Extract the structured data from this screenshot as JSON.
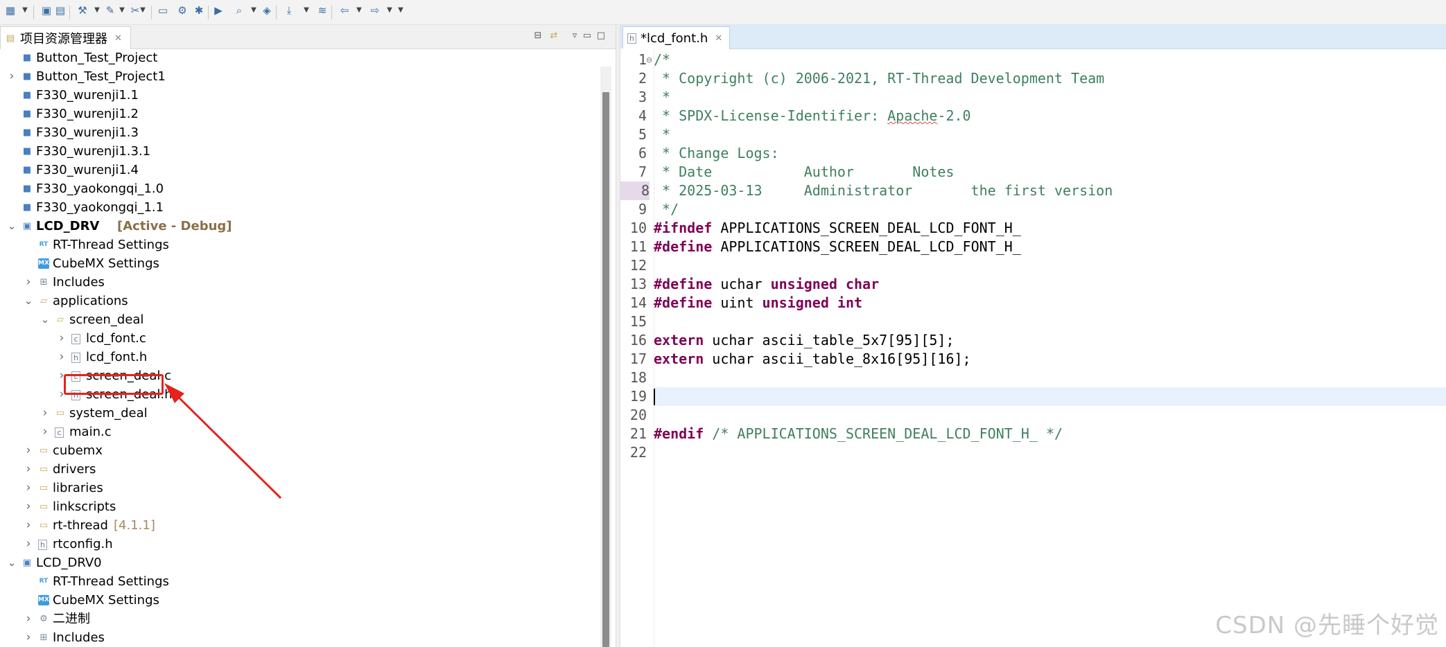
{
  "toolbar": {
    "icons": [
      "new-icon",
      "save-icon",
      "save-all-icon",
      "build-icon",
      "clean-icon",
      "tools-icon",
      "monitor-icon",
      "settings-icon",
      "debug-icon",
      "run-icon",
      "search-icon",
      "layers-icon",
      "download-icon",
      "stack-icon",
      "back-icon",
      "forward-icon"
    ]
  },
  "explorer": {
    "tab_label": "项目资源管理器",
    "tab_close": "✕"
  },
  "tree": [
    {
      "label": "Button_Test_Project",
      "deco": "",
      "bold": false,
      "depth": 0,
      "twisty": "",
      "icon": "project"
    },
    {
      "label": "Button_Test_Project1",
      "deco": "",
      "bold": false,
      "depth": 0,
      "twisty": ">",
      "icon": "project"
    },
    {
      "label": "F330_wurenji1.1",
      "deco": "",
      "bold": false,
      "depth": 0,
      "twisty": "",
      "icon": "project"
    },
    {
      "label": "F330_wurenji1.2",
      "deco": "",
      "bold": false,
      "depth": 0,
      "twisty": "",
      "icon": "project"
    },
    {
      "label": "F330_wurenji1.3",
      "deco": "",
      "bold": false,
      "depth": 0,
      "twisty": "",
      "icon": "project"
    },
    {
      "label": "F330_wurenji1.3.1",
      "deco": "",
      "bold": false,
      "depth": 0,
      "twisty": "",
      "icon": "project"
    },
    {
      "label": "F330_wurenji1.4",
      "deco": "",
      "bold": false,
      "depth": 0,
      "twisty": "",
      "icon": "project"
    },
    {
      "label": "F330_yaokongqi_1.0",
      "deco": "",
      "bold": false,
      "depth": 0,
      "twisty": "",
      "icon": "project"
    },
    {
      "label": "F330_yaokongqi_1.1",
      "deco": "",
      "bold": false,
      "depth": 0,
      "twisty": "",
      "icon": "project"
    },
    {
      "label": "LCD_DRV",
      "deco": "[Active - Debug]",
      "bold": true,
      "depth": 0,
      "twisty": "v",
      "icon": "project-active"
    },
    {
      "label": "RT-Thread Settings",
      "deco": "",
      "bold": false,
      "depth": 1,
      "twisty": "",
      "icon": "rt"
    },
    {
      "label": "CubeMX Settings",
      "deco": "",
      "bold": false,
      "depth": 1,
      "twisty": "",
      "icon": "mx"
    },
    {
      "label": "Includes",
      "deco": "",
      "bold": false,
      "depth": 1,
      "twisty": ">",
      "icon": "includes"
    },
    {
      "label": "applications",
      "deco": "",
      "bold": false,
      "depth": 1,
      "twisty": "v",
      "icon": "folder-open"
    },
    {
      "label": "screen_deal",
      "deco": "",
      "bold": false,
      "depth": 2,
      "twisty": "v",
      "icon": "folder-open"
    },
    {
      "label": "lcd_font.c",
      "deco": "",
      "bold": false,
      "depth": 3,
      "twisty": ">",
      "icon": "c-file"
    },
    {
      "label": "lcd_font.h",
      "deco": "",
      "bold": false,
      "depth": 3,
      "twisty": ">",
      "icon": "h-file"
    },
    {
      "label": "screen_deal.c",
      "deco": "",
      "bold": false,
      "depth": 3,
      "twisty": ">",
      "icon": "c-file"
    },
    {
      "label": "screen_deal.h",
      "deco": "",
      "bold": false,
      "depth": 3,
      "twisty": ">",
      "icon": "h-file"
    },
    {
      "label": "system_deal",
      "deco": "",
      "bold": false,
      "depth": 2,
      "twisty": ">",
      "icon": "folder"
    },
    {
      "label": "main.c",
      "deco": "",
      "bold": false,
      "depth": 2,
      "twisty": ">",
      "icon": "c-file"
    },
    {
      "label": "cubemx",
      "deco": "",
      "bold": false,
      "depth": 1,
      "twisty": ">",
      "icon": "folder"
    },
    {
      "label": "drivers",
      "deco": "",
      "bold": false,
      "depth": 1,
      "twisty": ">",
      "icon": "folder"
    },
    {
      "label": "libraries",
      "deco": "",
      "bold": false,
      "depth": 1,
      "twisty": ">",
      "icon": "folder"
    },
    {
      "label": "linkscripts",
      "deco": "",
      "bold": false,
      "depth": 1,
      "twisty": ">",
      "icon": "folder"
    },
    {
      "label": "rt-thread",
      "deco": "[4.1.1]",
      "bold": false,
      "depth": 1,
      "twisty": ">",
      "icon": "folder"
    },
    {
      "label": "rtconfig.h",
      "deco": "",
      "bold": false,
      "depth": 1,
      "twisty": ">",
      "icon": "h-file"
    },
    {
      "label": "LCD_DRV0",
      "deco": "",
      "bold": false,
      "depth": 0,
      "twisty": "v",
      "icon": "project-active"
    },
    {
      "label": "RT-Thread Settings",
      "deco": "",
      "bold": false,
      "depth": 1,
      "twisty": "",
      "icon": "rt"
    },
    {
      "label": "CubeMX Settings",
      "deco": "",
      "bold": false,
      "depth": 1,
      "twisty": "",
      "icon": "mx"
    },
    {
      "label": "二进制",
      "deco": "",
      "bold": false,
      "depth": 1,
      "twisty": ">",
      "icon": "binary"
    },
    {
      "label": "Includes",
      "deco": "",
      "bold": false,
      "depth": 1,
      "twisty": ">",
      "icon": "includes"
    }
  ],
  "editor": {
    "tab_label": "*lcd_font.h",
    "tab_close": "✕",
    "lines": [
      [
        {
          "t": "/*",
          "c": "comment"
        }
      ],
      [
        {
          "t": " * Copyright (c) 2006-2021, RT-Thread Development Team",
          "c": "comment"
        }
      ],
      [
        {
          "t": " *",
          "c": "comment"
        }
      ],
      [
        {
          "t": " * SPDX-License-Identifier: ",
          "c": "comment"
        },
        {
          "t": "Apache",
          "c": "comment-squig"
        },
        {
          "t": "-2.0",
          "c": "comment"
        }
      ],
      [
        {
          "t": " *",
          "c": "comment"
        }
      ],
      [
        {
          "t": " * Change Logs:",
          "c": "comment"
        }
      ],
      [
        {
          "t": " * Date           Author       Notes",
          "c": "comment"
        }
      ],
      [
        {
          "t": " * 2025-03-13     Administrator       the first version",
          "c": "comment"
        }
      ],
      [
        {
          "t": " */",
          "c": "comment"
        }
      ],
      [
        {
          "t": "#ifndef",
          "c": "kw"
        },
        {
          "t": " APPLICATIONS_SCREEN_DEAL_LCD_FONT_H_",
          "c": "plain"
        }
      ],
      [
        {
          "t": "#define",
          "c": "kw"
        },
        {
          "t": " APPLICATIONS_SCREEN_DEAL_LCD_FONT_H_",
          "c": "plain"
        }
      ],
      [],
      [
        {
          "t": "#define",
          "c": "kw"
        },
        {
          "t": " uchar ",
          "c": "plain"
        },
        {
          "t": "unsigned",
          "c": "kw"
        },
        {
          "t": " ",
          "c": "plain"
        },
        {
          "t": "char",
          "c": "kw"
        }
      ],
      [
        {
          "t": "#define",
          "c": "kw"
        },
        {
          "t": " uint ",
          "c": "plain"
        },
        {
          "t": "unsigned",
          "c": "kw"
        },
        {
          "t": " ",
          "c": "plain"
        },
        {
          "t": "int",
          "c": "kw"
        }
      ],
      [],
      [
        {
          "t": "extern",
          "c": "kw"
        },
        {
          "t": " uchar ascii_table_5x7[95][5];",
          "c": "plain"
        }
      ],
      [
        {
          "t": "extern",
          "c": "kw"
        },
        {
          "t": " uchar ascii_table_8x16[95][16];",
          "c": "plain"
        }
      ],
      [],
      [],
      [],
      [
        {
          "t": "#endif",
          "c": "kw"
        },
        {
          "t": " ",
          "c": "plain"
        },
        {
          "t": "/* APPLICATIONS_SCREEN_DEAL_LCD_FONT_H_ */",
          "c": "comment"
        }
      ],
      []
    ],
    "line_numbers": [
      "1",
      "2",
      "3",
      "4",
      "5",
      "6",
      "7",
      "8",
      "9",
      "10",
      "11",
      "12",
      "13",
      "14",
      "15",
      "16",
      "17",
      "18",
      "19",
      "20",
      "21",
      "22"
    ],
    "current_line": "19",
    "marked_line": "8"
  },
  "watermark": "CSDN @先睡个好觉",
  "colors": {
    "comment": "#3f7f5f",
    "keyword": "#7f0055",
    "highlight_box": "#e5231b",
    "current_line_bg": "#e8f2fe"
  }
}
